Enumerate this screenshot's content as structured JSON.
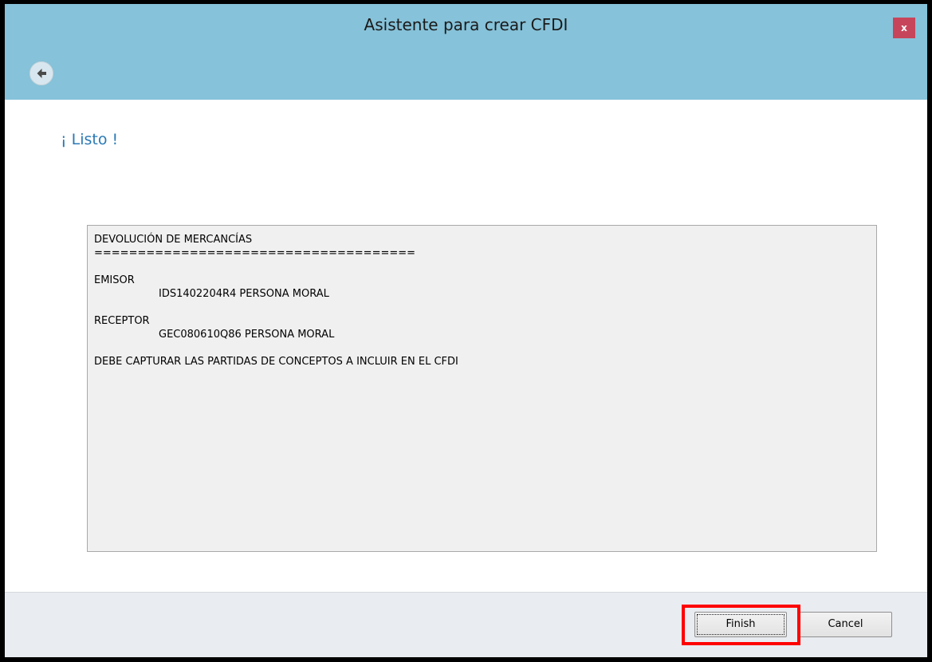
{
  "window": {
    "title": "Asistente para crear CFDI",
    "close_label": "x"
  },
  "nav": {
    "back_icon": "back-arrow-icon"
  },
  "page": {
    "heading": "¡ Listo !"
  },
  "summary": {
    "title": "DEVOLUCIÓN DE MERCANCÍAS",
    "separator": "=====================================",
    "emisor_label": "EMISOR",
    "emisor_value": "IDS1402204R4 PERSONA MORAL",
    "receptor_label": "RECEPTOR",
    "receptor_value": "GEC080610Q86 PERSONA MORAL",
    "note": "DEBE CAPTURAR LAS PARTIDAS DE CONCEPTOS A INCLUIR EN EL CFDI"
  },
  "footer": {
    "finish_label": "Finish",
    "cancel_label": "Cancel"
  },
  "colors": {
    "titlebar": "#86c2d9",
    "heading": "#2a79b5",
    "close_button": "#c7455a",
    "highlight": "#ff0000"
  }
}
